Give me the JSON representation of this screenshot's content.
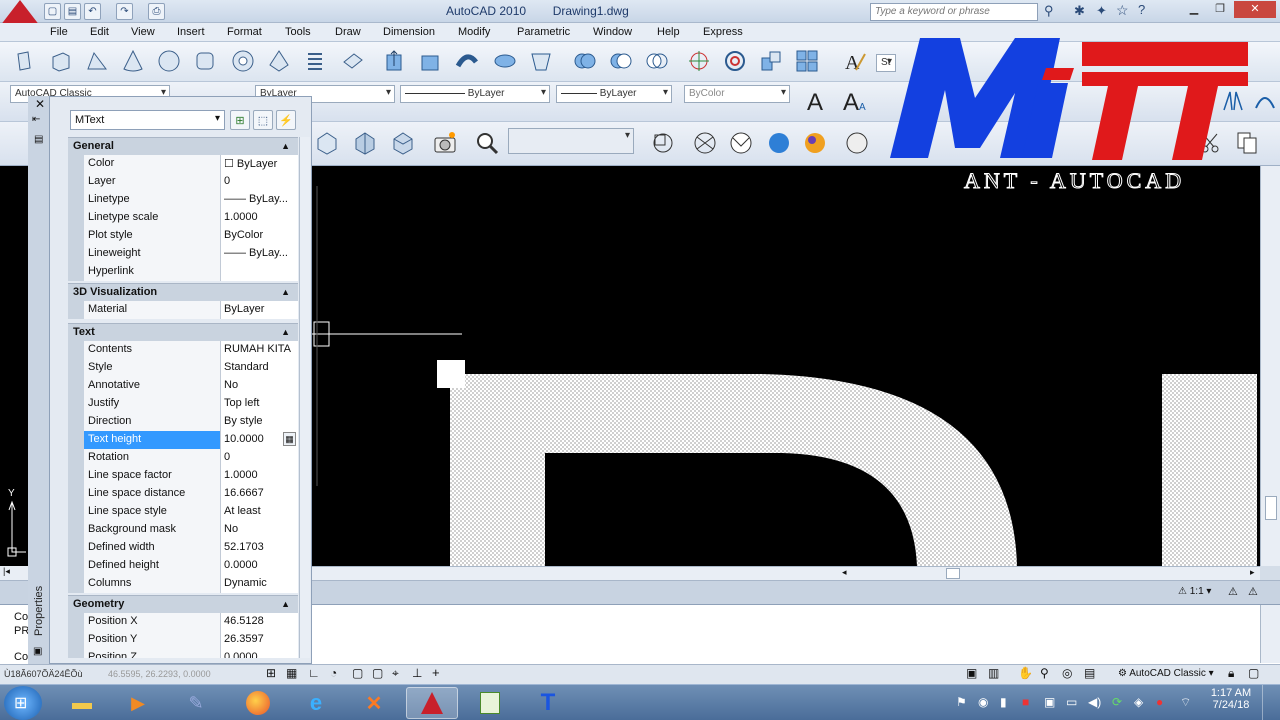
{
  "window": {
    "app_title": "AutoCAD 2010",
    "doc_title": "Drawing1.dwg",
    "search_placeholder": "Type a keyword or phrase"
  },
  "menu": [
    "File",
    "Edit",
    "View",
    "Insert",
    "Format",
    "Tools",
    "Draw",
    "Dimension",
    "Modify",
    "Parametric",
    "Window",
    "Help",
    "Express"
  ],
  "toolbar": {
    "workspace": "AutoCAD Classic",
    "layer_linetype": "ByLayer",
    "lineweight": "ByLayer",
    "plotstyle": "ByColor",
    "text_style_initial": "St"
  },
  "properties": {
    "object_type": "MText",
    "vertical_label": "Properties",
    "sections": [
      {
        "title": "General",
        "rows": [
          {
            "label": "Color",
            "value": "☐ ByLayer"
          },
          {
            "label": "Layer",
            "value": "0"
          },
          {
            "label": "Linetype",
            "value": "—— ByLay..."
          },
          {
            "label": "Linetype scale",
            "value": "1.0000"
          },
          {
            "label": "Plot style",
            "value": "ByColor"
          },
          {
            "label": "Lineweight",
            "value": "—— ByLay..."
          },
          {
            "label": "Hyperlink",
            "value": ""
          }
        ]
      },
      {
        "title": "3D Visualization",
        "rows": [
          {
            "label": "Material",
            "value": "ByLayer"
          }
        ]
      },
      {
        "title": "Text",
        "rows": [
          {
            "label": "Contents",
            "value": "RUMAH KITA"
          },
          {
            "label": "Style",
            "value": "Standard"
          },
          {
            "label": "Annotative",
            "value": "No"
          },
          {
            "label": "Justify",
            "value": "Top left"
          },
          {
            "label": "Direction",
            "value": "By style"
          },
          {
            "label": "Text height",
            "value": "10.0000",
            "selected": true
          },
          {
            "label": "Rotation",
            "value": "0"
          },
          {
            "label": "Line space factor",
            "value": "1.0000"
          },
          {
            "label": "Line space distance",
            "value": "16.6667"
          },
          {
            "label": "Line space style",
            "value": "At least"
          },
          {
            "label": "Background mask",
            "value": "No"
          },
          {
            "label": "Defined width",
            "value": "52.1703"
          },
          {
            "label": "Defined height",
            "value": "0.0000"
          },
          {
            "label": "Columns",
            "value": "Dynamic"
          }
        ]
      },
      {
        "title": "Geometry",
        "rows": [
          {
            "label": "Position X",
            "value": "46.5128"
          },
          {
            "label": "Position Y",
            "value": "26.3597"
          },
          {
            "label": "Position Z",
            "value": "0.0000"
          }
        ]
      }
    ]
  },
  "canvas": {
    "ucs_y": "Y",
    "command_prefix_1": "Co",
    "command_prefix_2": "PR",
    "command_prefix_3": "Co"
  },
  "status": {
    "coords": "46.5595, 26.2293, 0.0000",
    "left_text": "Ù18Ã607ÕÄ24ÊÕù",
    "annotation_scale": "1:1",
    "workspace": "AutoCAD Classic"
  },
  "watermark": {
    "logo": "MiTT",
    "subtitle": "ANT - AUTOCAD"
  },
  "taskbar": {
    "time": "1:17 AM",
    "date": "7/24/18",
    "t_app": "T"
  }
}
